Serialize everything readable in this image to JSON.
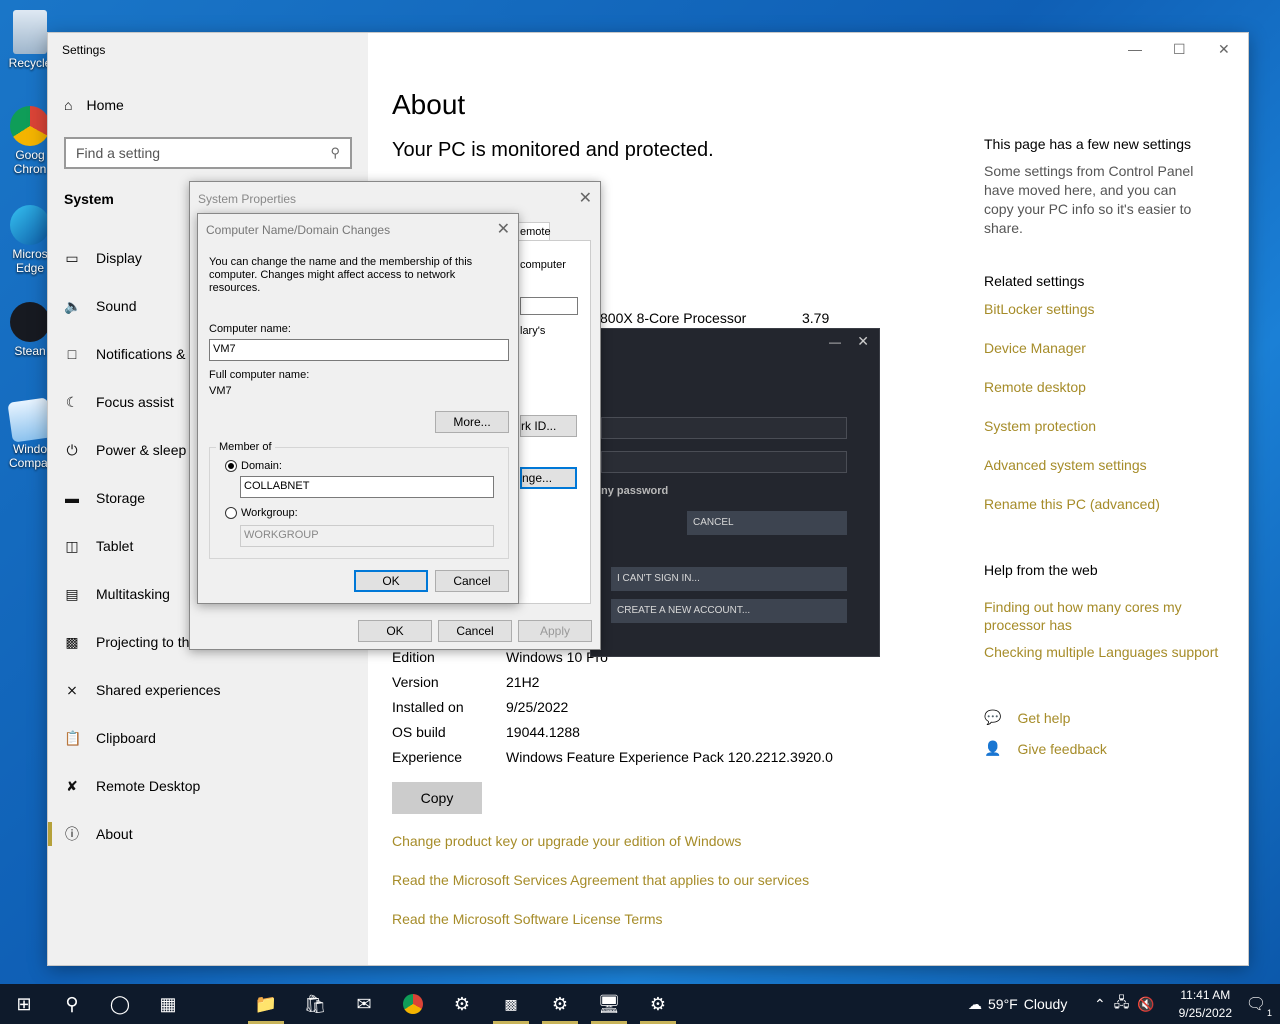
{
  "desktop": {
    "icons": [
      {
        "label": "Recycle",
        "name": "recycle-bin"
      },
      {
        "label": "Goog Chron",
        "name": "google-chrome"
      },
      {
        "label": "Micros Edge",
        "name": "microsoft-edge"
      },
      {
        "label": "Stean",
        "name": "steam"
      },
      {
        "label": "Windo Compat",
        "name": "windows-compat"
      }
    ]
  },
  "settings": {
    "app_title": "Settings",
    "home_label": "Home",
    "search_placeholder": "Find a setting",
    "section_title": "System",
    "nav": [
      {
        "label": "Display",
        "icon": "display-icon"
      },
      {
        "label": "Sound",
        "icon": "sound-icon"
      },
      {
        "label": "Notifications &",
        "icon": "notifications-icon"
      },
      {
        "label": "Focus assist",
        "icon": "focus-assist-icon"
      },
      {
        "label": "Power & sleep",
        "icon": "power-icon"
      },
      {
        "label": "Storage",
        "icon": "storage-icon"
      },
      {
        "label": "Tablet",
        "icon": "tablet-icon"
      },
      {
        "label": "Multitasking",
        "icon": "multitasking-icon"
      },
      {
        "label": "Projecting to th",
        "icon": "projecting-icon"
      },
      {
        "label": "Shared experiences",
        "icon": "shared-icon"
      },
      {
        "label": "Clipboard",
        "icon": "clipboard-icon"
      },
      {
        "label": "Remote Desktop",
        "icon": "remote-desktop-icon"
      },
      {
        "label": "About",
        "icon": "info-icon"
      }
    ],
    "page_title": "About",
    "protected_text": "Your PC is monitored and protected.",
    "processor_partial": "800X 8-Core Processor",
    "processor_speed_partial": "3.79",
    "specs": [
      {
        "key": "Edition",
        "value": "Windows 10 Pro"
      },
      {
        "key": "Version",
        "value": "21H2"
      },
      {
        "key": "Installed on",
        "value": "9/25/2022"
      },
      {
        "key": "OS build",
        "value": "19044.1288"
      },
      {
        "key": "Experience",
        "value": "Windows Feature Experience Pack 120.2212.3920.0"
      }
    ],
    "copy_label": "Copy",
    "links": [
      "Change product key or upgrade your edition of Windows",
      "Read the Microsoft Services Agreement that applies to our services",
      "Read the Microsoft Software License Terms"
    ],
    "side": {
      "new_settings_title": "This page has a few new settings",
      "new_settings_text": "Some settings from Control Panel have moved here, and you can copy your PC info so it's easier to share.",
      "related_title": "Related settings",
      "related_links": [
        "BitLocker settings",
        "Device Manager",
        "Remote desktop",
        "System protection",
        "Advanced system settings",
        "Rename this PC (advanced)"
      ],
      "help_title": "Help from the web",
      "help_links": [
        "Finding out how many cores my processor has",
        "Checking multiple Languages support"
      ],
      "get_help": "Get help",
      "give_feedback": "Give feedback"
    }
  },
  "system_properties": {
    "title": "System Properties",
    "tab_partial": "emote",
    "text_computer": "computer",
    "text_lary": "lary's",
    "network_id_partial": "rk ID...",
    "change_partial": "nge...",
    "ok": "OK",
    "cancel": "Cancel",
    "apply": "Apply"
  },
  "computer_name_dialog": {
    "title": "Computer Name/Domain Changes",
    "description": "You can change the name and the membership of this computer. Changes might affect access to network resources.",
    "computer_name_label": "Computer name:",
    "computer_name_value": "VM7",
    "full_name_label": "Full computer name:",
    "full_name_value": "VM7",
    "more_label": "More...",
    "member_of_label": "Member of",
    "domain_label": "Domain:",
    "domain_value": "COLLABNET",
    "workgroup_label": "Workgroup:",
    "workgroup_value": "WORKGROUP",
    "ok": "OK",
    "cancel": "Cancel"
  },
  "steam_dialog": {
    "remember_text": "ny password",
    "cancel": "CANCEL",
    "cant_sign_in": "I CAN'T SIGN IN...",
    "create_account": "CREATE A NEW ACCOUNT..."
  },
  "taskbar": {
    "weather_temp": "59°F",
    "weather_text": "Cloudy",
    "time": "11:41 AM",
    "date": "9/25/2022",
    "notification_count": "1"
  },
  "colors": {
    "accent_link": "#a68c29",
    "desktop_blue": "#1a76c8",
    "taskbar": "#0e1a2b"
  }
}
